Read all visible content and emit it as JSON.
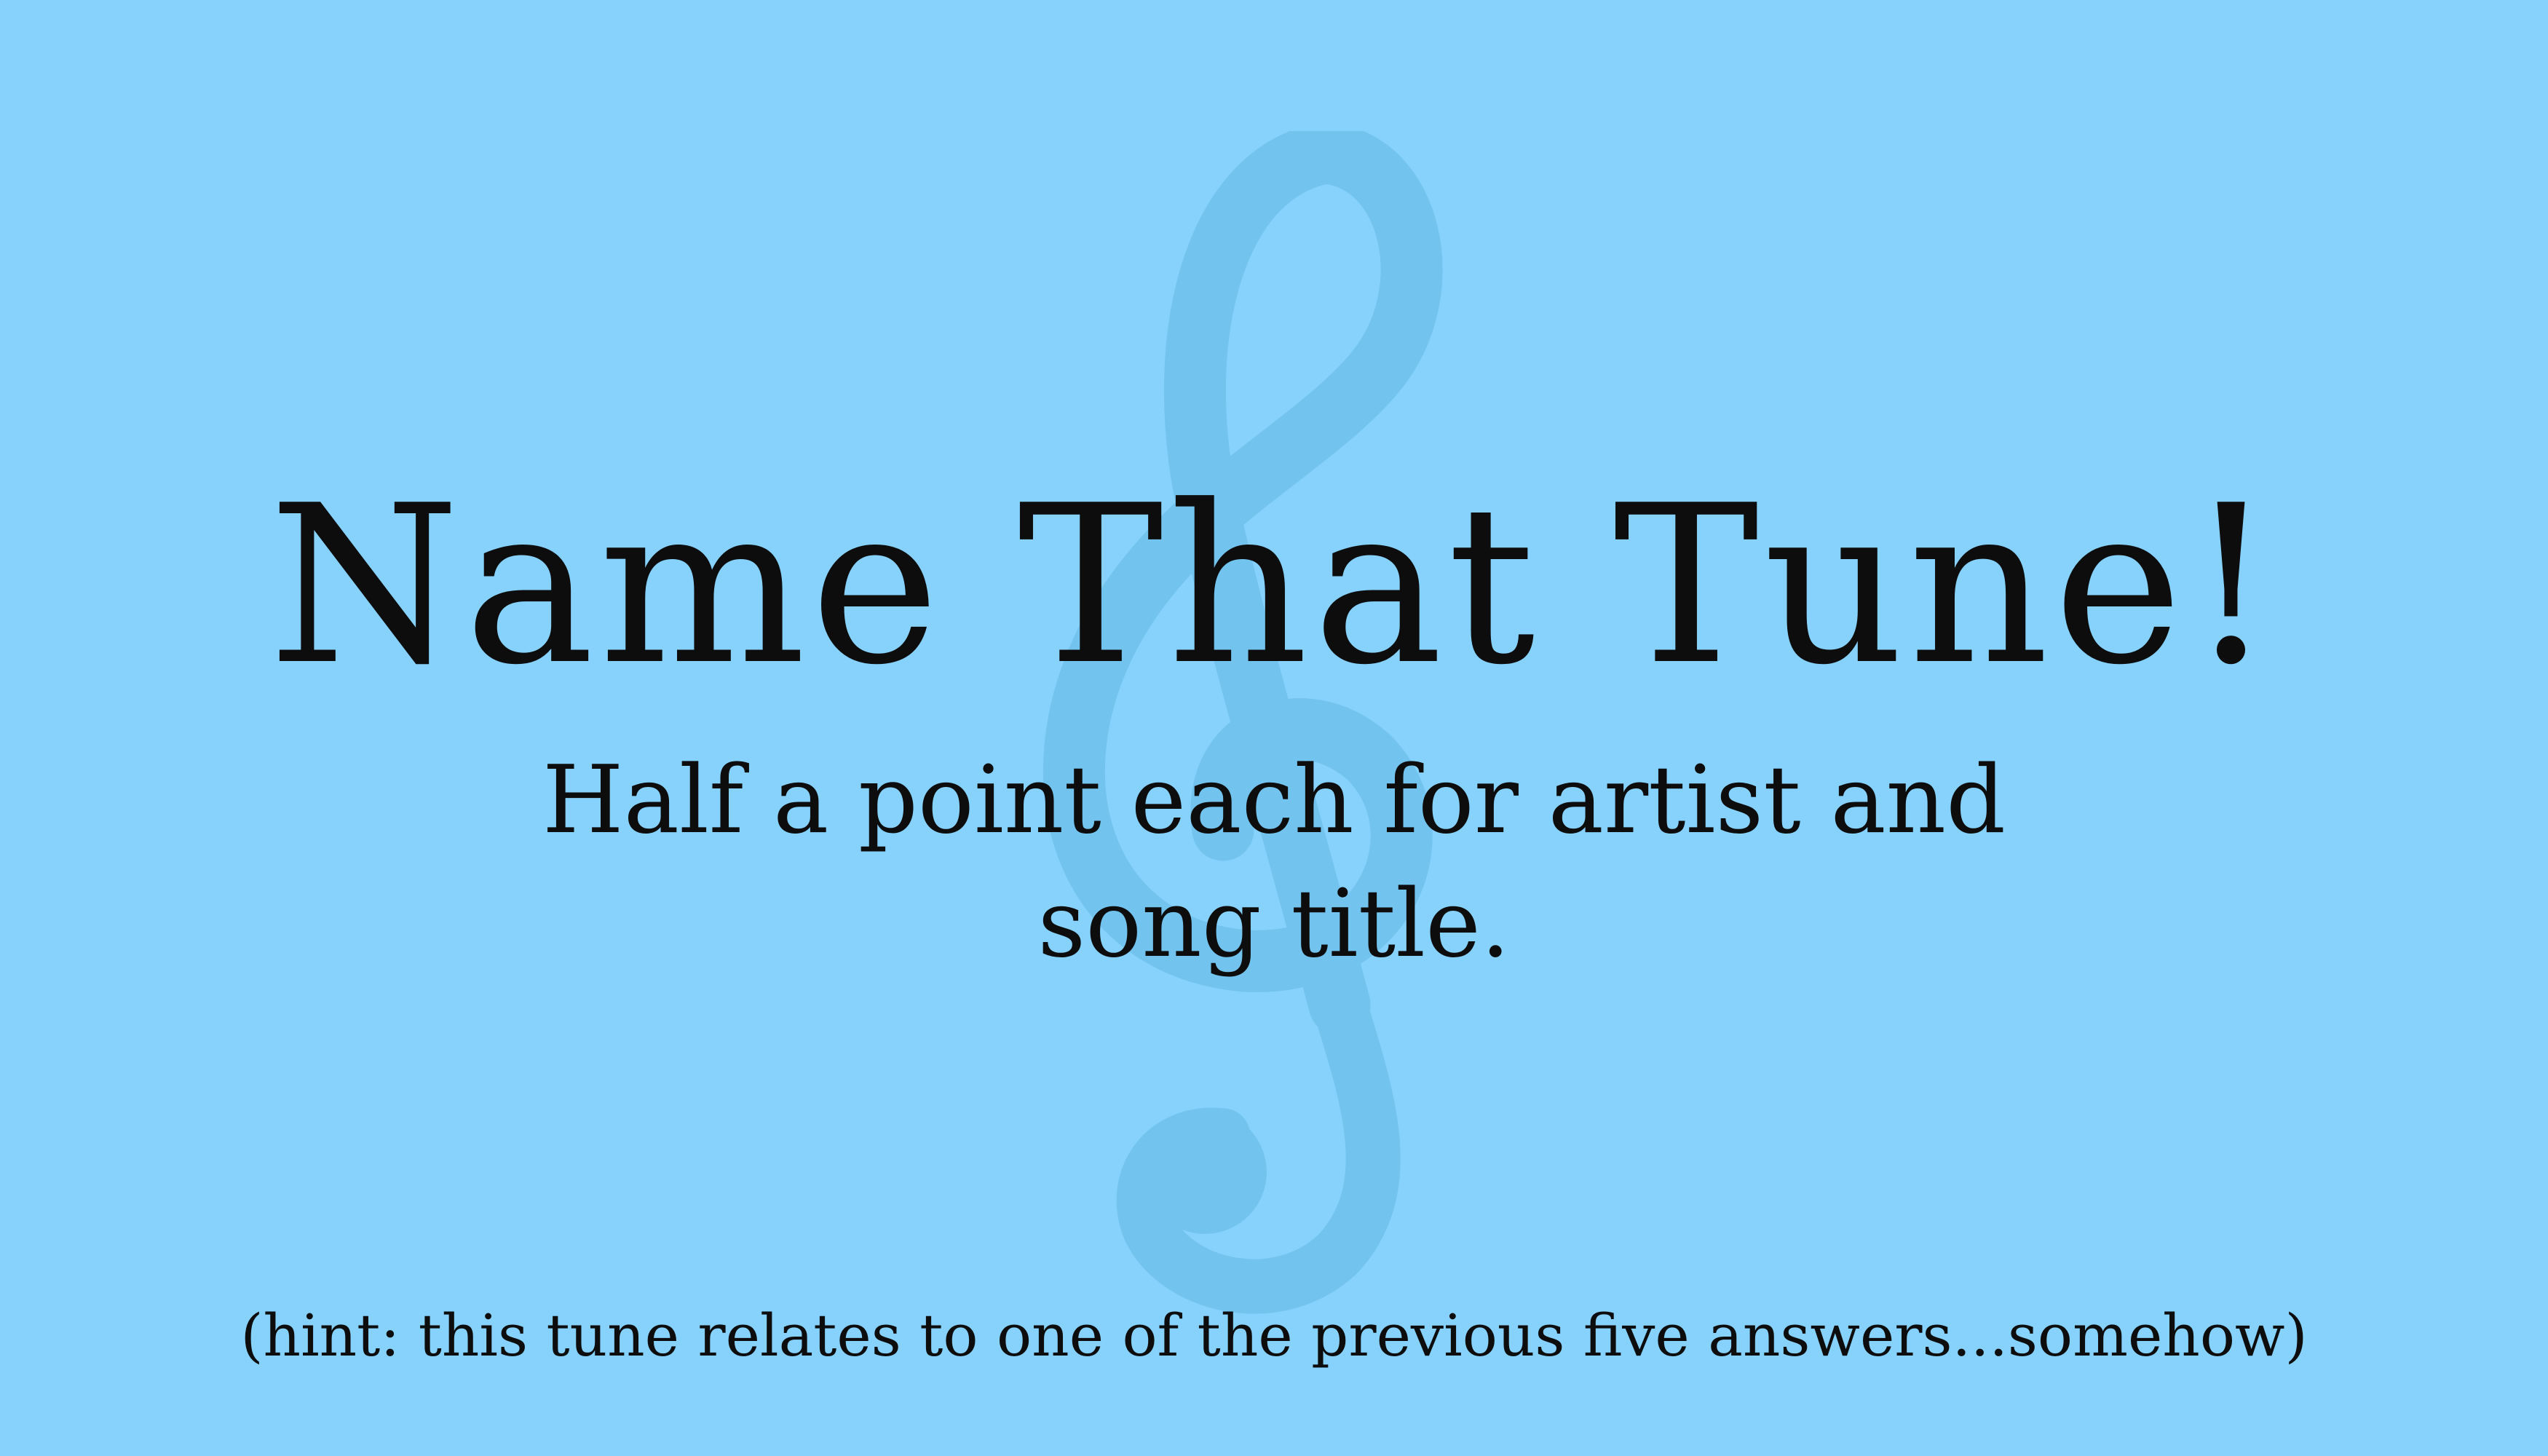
{
  "slide": {
    "background_color": "#87d2fd",
    "watermark_icon": "treble-clef-icon",
    "watermark_color": "#73c3ef",
    "title": "Name That Tune!",
    "subtitle_lines": [
      "Half a point each for artist and",
      "song title."
    ],
    "hint": "(hint: this tune relates to one of the previous five answers...somehow)"
  }
}
